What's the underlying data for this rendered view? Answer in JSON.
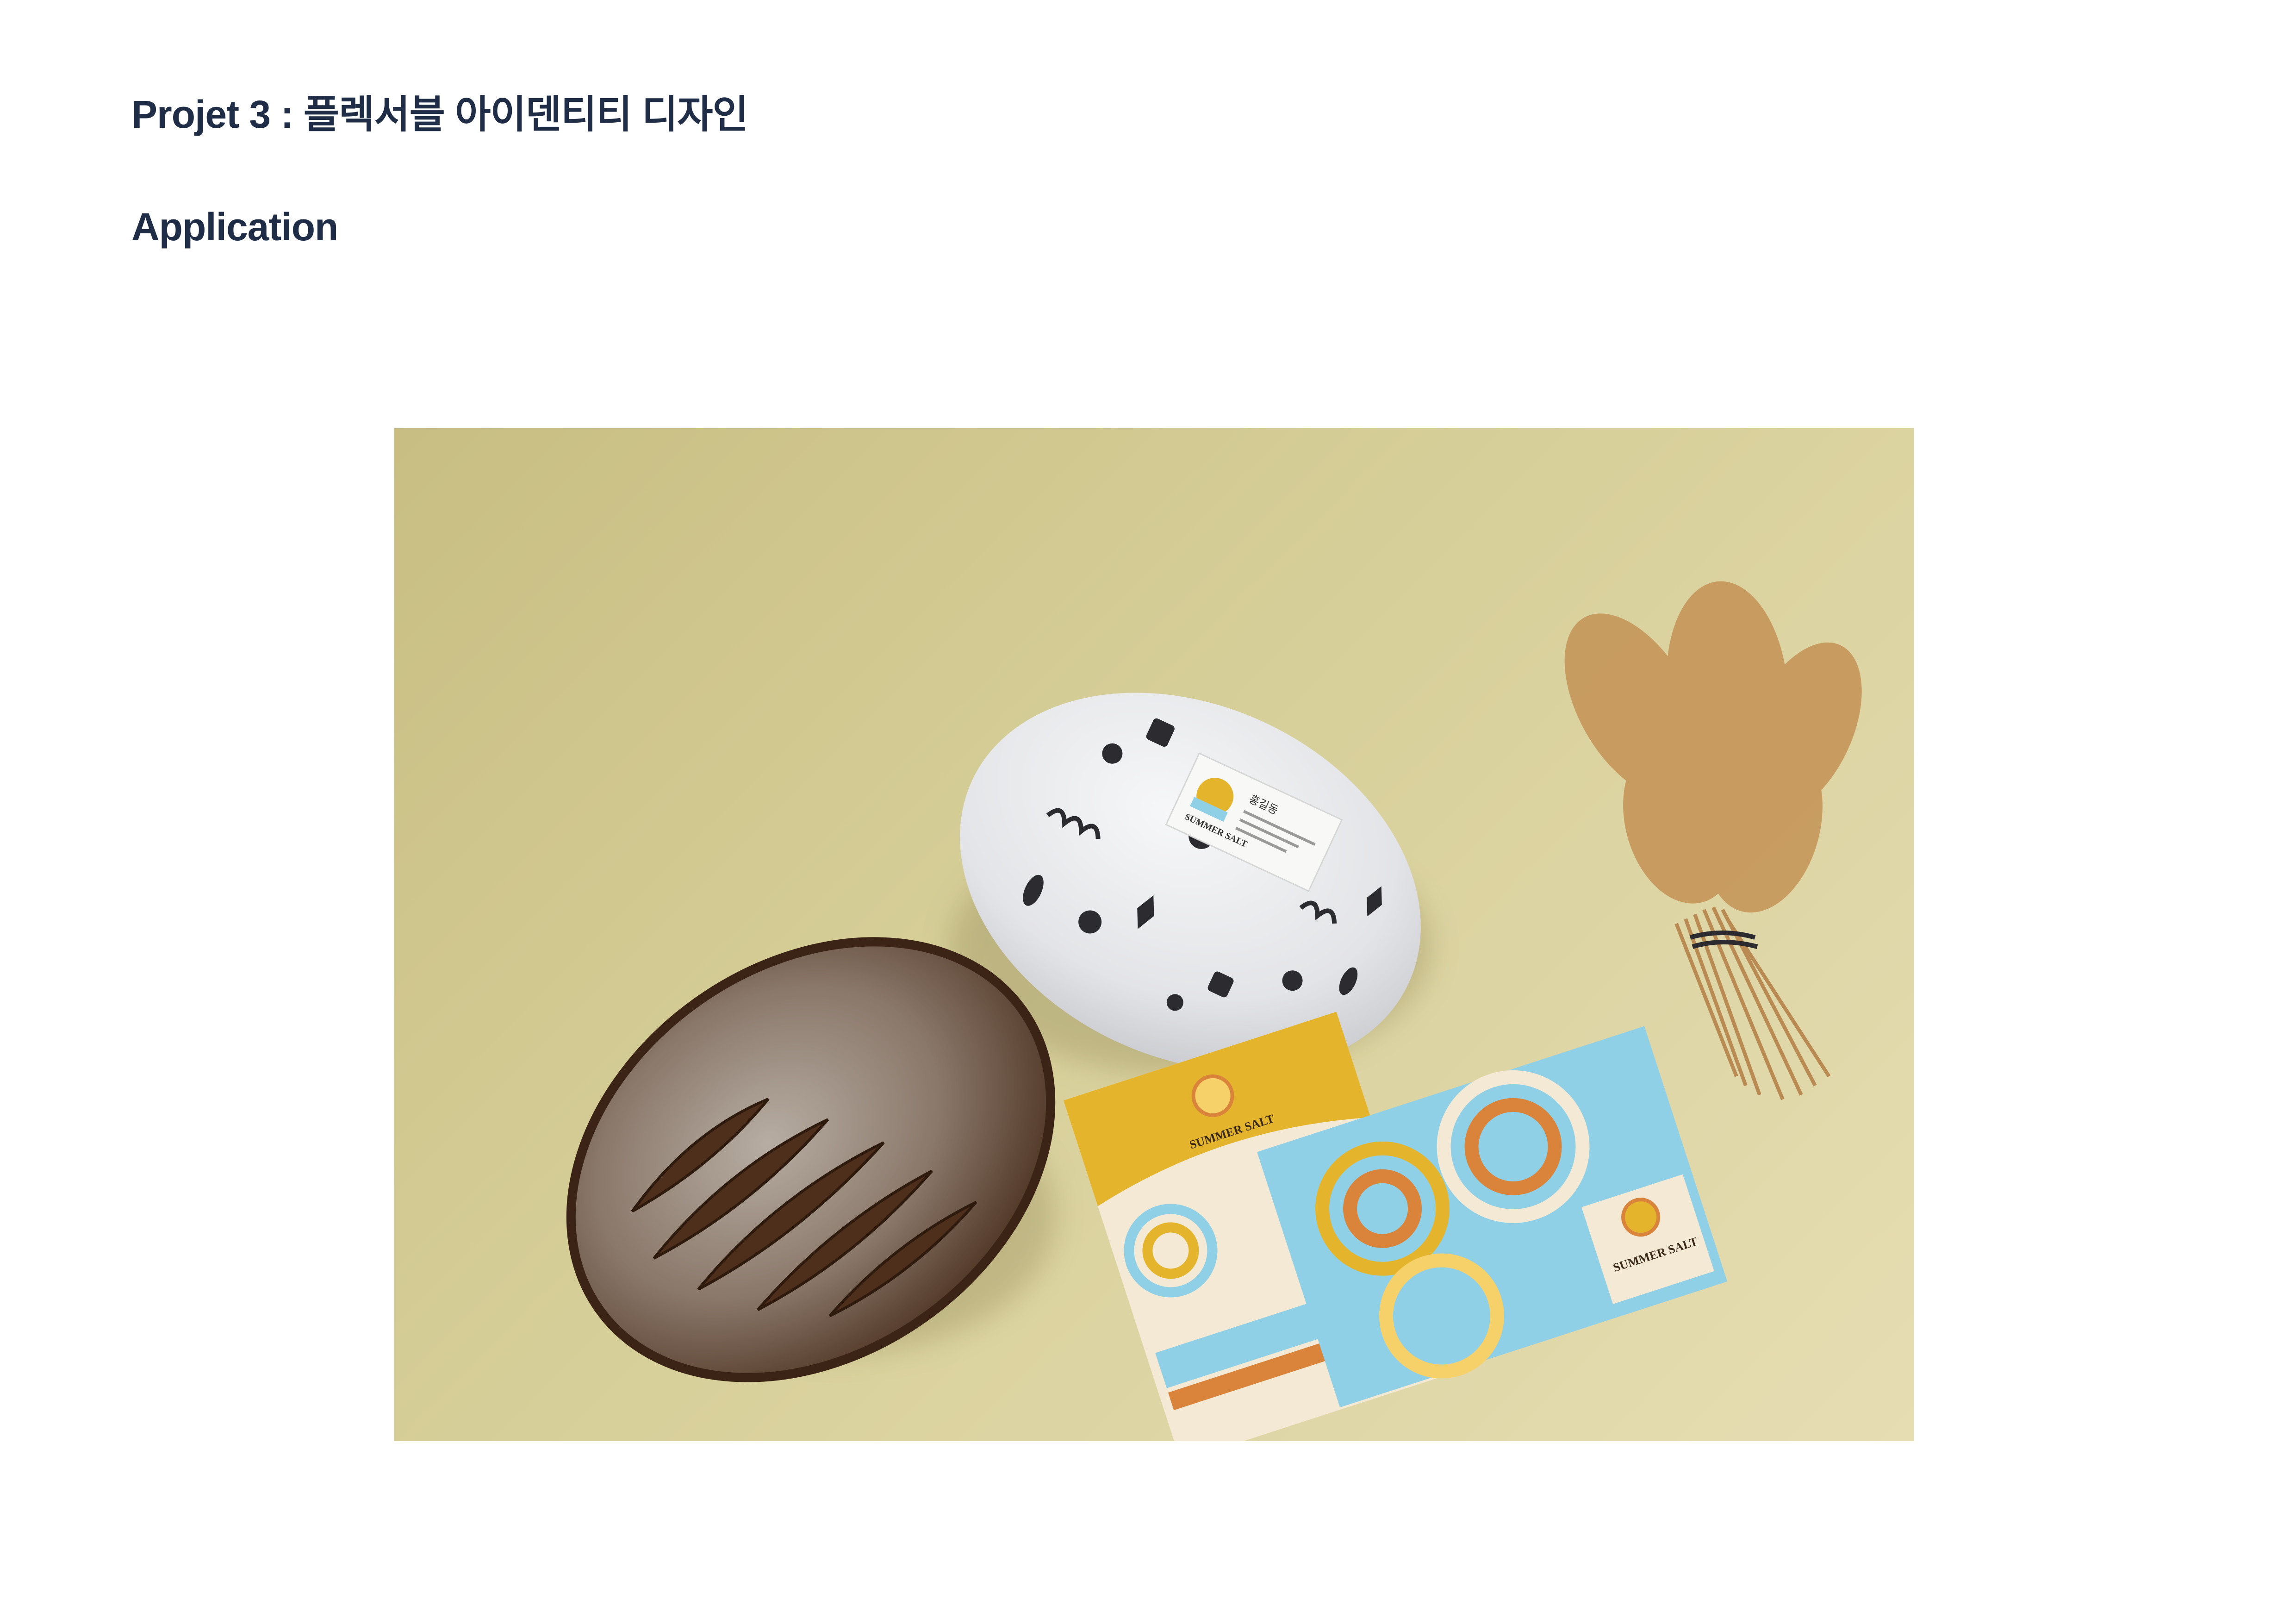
{
  "header": {
    "title": "Projet 3 : 플렉서블 아이덴티티 디자인",
    "subtitle": "Application"
  },
  "mockup": {
    "brand_name": "SUMMER SALT",
    "label_name": "홍길동",
    "colors": {
      "background": "#d3ca92",
      "wrap_paper": "#e9eaec",
      "pattern": "#2b2b30",
      "brand_yellow": "#e4b52c",
      "brand_blue": "#8fd0e6",
      "brand_orange": "#d9843a",
      "bread_crust": "#5a3a26",
      "wheat": "#b98a52"
    }
  }
}
